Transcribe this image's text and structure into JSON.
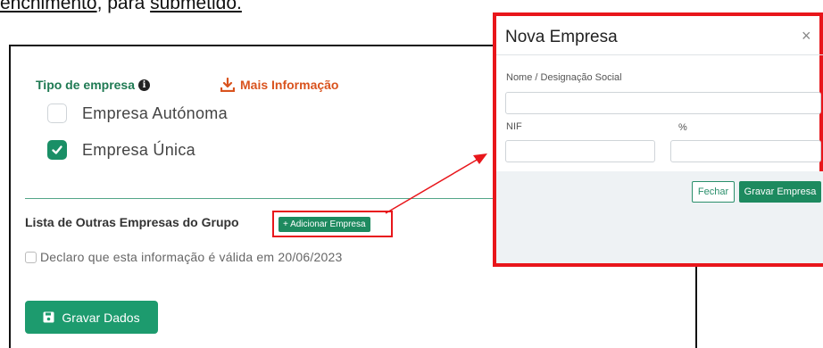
{
  "top_text": {
    "word1": "enchimento",
    "sep": ", para ",
    "word2": "submetido."
  },
  "form": {
    "tipo_label": "Tipo de empresa",
    "info_glyph": "i",
    "mais_info": "Mais Informação",
    "options": [
      {
        "label": "Empresa Autónoma",
        "checked": false
      },
      {
        "label": "Empresa Única",
        "checked": true
      }
    ],
    "lista_label": "Lista de Outras Empresas do Grupo",
    "add_button": "+ Adicionar Empresa",
    "declaro": "Declaro que esta informação é válida em 20/06/2023",
    "gravar_dados": "Gravar Dados"
  },
  "modal": {
    "title": "Nova Empresa",
    "close": "×",
    "nome_label": "Nome / Designação Social",
    "nif_label": "NIF",
    "pct_label": "%",
    "fechar": "Fechar",
    "gravar_empresa": "Gravar Empresa"
  },
  "colors": {
    "accent_green": "#1d8a5f",
    "highlight_red": "#e8161b",
    "info_orange": "#d9531e"
  },
  "icons": [
    "info-icon",
    "download-icon",
    "checkbox-icon",
    "save-icon",
    "close-icon"
  ]
}
